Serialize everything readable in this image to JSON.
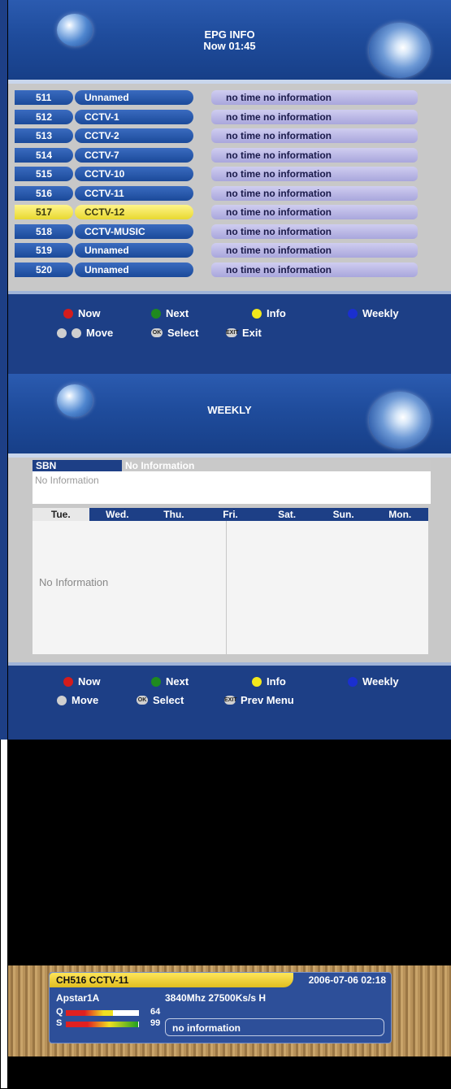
{
  "epg": {
    "title": "EPG INFO",
    "subtitle": "Now  01:45",
    "rows": [
      {
        "num": "511",
        "name": "Unnamed",
        "info": "no time no information",
        "selected": false
      },
      {
        "num": "512",
        "name": "CCTV-1",
        "info": "no time no information",
        "selected": false
      },
      {
        "num": "513",
        "name": "CCTV-2",
        "info": "no time no information",
        "selected": false
      },
      {
        "num": "514",
        "name": "CCTV-7",
        "info": "no time no information",
        "selected": false
      },
      {
        "num": "515",
        "name": "CCTV-10",
        "info": "no time no information",
        "selected": false
      },
      {
        "num": "516",
        "name": "CCTV-11",
        "info": "no time no information",
        "selected": false
      },
      {
        "num": "517",
        "name": "CCTV-12",
        "info": "no time no information",
        "selected": true
      },
      {
        "num": "518",
        "name": "CCTV-MUSIC",
        "info": "no time no information",
        "selected": false
      },
      {
        "num": "519",
        "name": "Unnamed",
        "info": "no time no information",
        "selected": false
      },
      {
        "num": "520",
        "name": "Unnamed",
        "info": "no time no information",
        "selected": false
      }
    ],
    "legend": {
      "now": "Now",
      "next": "Next",
      "info": "Info",
      "weekly": "Weekly",
      "move": "Move",
      "select": "Select",
      "exit": "Exit"
    }
  },
  "weekly": {
    "title": "WEEKLY",
    "channel": "SBN",
    "channel_info": "No Information",
    "description": "No Information",
    "days": [
      "Tue.",
      "Wed.",
      "Thu.",
      "Fri.",
      "Sat.",
      "Sun.",
      "Mon."
    ],
    "active_day": 0,
    "program_text": "No Information",
    "legend": {
      "now": "Now",
      "next": "Next",
      "info": "Info",
      "weekly": "Weekly",
      "move": "Move",
      "select": "Select",
      "prev": "Prev Menu"
    }
  },
  "infobar": {
    "channel": "CH516  CCTV-11",
    "datetime": "2006-07-06 02:18",
    "satellite": "Apstar1A",
    "frequency": "3840Mhz 27500Ks/s H",
    "q_label": "Q",
    "q_value": "64",
    "s_label": "S",
    "s_value": "99",
    "program": "no information"
  },
  "colors": {
    "red": "#d41c1c",
    "green": "#1f8a1f",
    "yellow": "#f2e81c",
    "blue": "#1a2fd0",
    "panel": "#1d3f86",
    "selected": "#f3e65a"
  },
  "buttons": {
    "ok": "OK",
    "exit": "EXIT"
  }
}
